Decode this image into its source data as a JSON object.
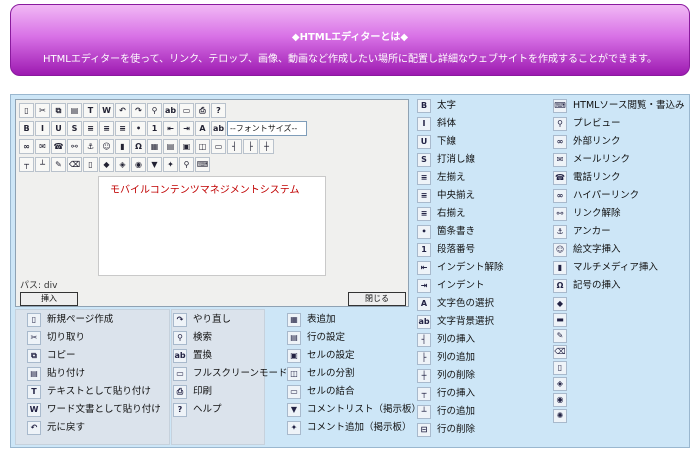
{
  "header": {
    "title": "◆HTMLエディターとは◆",
    "subtitle": "HTMLエディターを使って、リンク、テロップ、画像、動画など作成したい場所に配置し詳細なウェブサイトを作成することができます。"
  },
  "editor": {
    "font_size_select": "--フォントサイズ--",
    "sample_text": "モバイルコンテンツマネジメントシステム",
    "path_label": "パス: div",
    "insert_button": "挿入",
    "close_button": "閉じる"
  },
  "legend": {
    "col1": [
      "新規ページ作成",
      "切り取り",
      "コピー",
      "貼り付け",
      "テキストとして貼り付け",
      "ワード文書として貼り付け",
      "元に戻す"
    ],
    "col2": [
      "やり直し",
      "検索",
      "置換",
      "フルスクリーンモード",
      "印刷",
      "ヘルプ"
    ],
    "col3": [
      "表追加",
      "行の設定",
      "セルの設定",
      "セルの分割",
      "セルの結合",
      "コメントリスト（掲示板）",
      "コメント追加（掲示板）"
    ],
    "col4": [
      "太字",
      "斜体",
      "下線",
      "打消し線",
      "左揃え",
      "中央揃え",
      "右揃え",
      "箇条書き",
      "段落番号",
      "インデント解除",
      "インデント",
      "文字色の選択",
      "文字背景選択",
      "列の挿入",
      "列の追加",
      "列の削除",
      "行の挿入",
      "行の追加",
      "行の削除"
    ],
    "col5": [
      "HTMLソース閲覧・書込み",
      "プレビュー",
      "外部リンク",
      "メールリンク",
      "電話リンク",
      "ハイパーリンク",
      "リンク解除",
      "アンカー",
      "絵文字挿入",
      "マルチメディア挿入",
      "記号の挿入"
    ]
  }
}
